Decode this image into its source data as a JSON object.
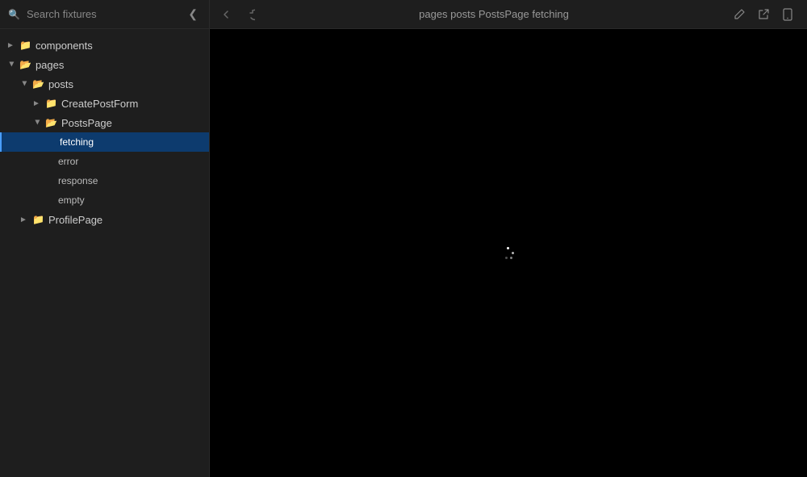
{
  "header": {
    "search_placeholder": "Search fixtures",
    "breadcrumb": "pages posts PostsPage fetching",
    "collapse_icon": "❮",
    "nav_back_icon": "←",
    "nav_forward_icon": "↻",
    "action_edit_icon": "edit",
    "action_external_icon": "external",
    "action_device_icon": "device"
  },
  "sidebar": {
    "tree": [
      {
        "id": "components",
        "label": "components",
        "type": "folder",
        "level": 1,
        "expanded": false,
        "children": []
      },
      {
        "id": "pages",
        "label": "pages",
        "type": "folder",
        "level": 1,
        "expanded": true,
        "children": [
          {
            "id": "posts",
            "label": "posts",
            "type": "folder",
            "level": 2,
            "expanded": true,
            "children": [
              {
                "id": "CreatePostForm",
                "label": "CreatePostForm",
                "type": "folder",
                "level": 3,
                "expanded": false,
                "children": []
              },
              {
                "id": "PostsPage",
                "label": "PostsPage",
                "type": "folder",
                "level": 3,
                "expanded": true,
                "children": [
                  {
                    "id": "fetching",
                    "label": "fetching",
                    "type": "fixture",
                    "level": 4,
                    "active": true
                  },
                  {
                    "id": "error",
                    "label": "error",
                    "type": "fixture",
                    "level": 4,
                    "active": false
                  },
                  {
                    "id": "response",
                    "label": "response",
                    "type": "fixture",
                    "level": 4,
                    "active": false
                  },
                  {
                    "id": "empty",
                    "label": "empty",
                    "type": "fixture",
                    "level": 4,
                    "active": false
                  }
                ]
              }
            ]
          },
          {
            "id": "ProfilePage",
            "label": "ProfilePage",
            "type": "folder",
            "level": 2,
            "expanded": false,
            "children": []
          }
        ]
      }
    ]
  },
  "main": {
    "background": "#000000",
    "loading": true
  },
  "colors": {
    "sidebar_bg": "#1e1e1e",
    "active_bg": "#0d3b6e",
    "active_border": "#4a9eff",
    "text_primary": "#cccccc",
    "text_muted": "#888888",
    "folder_color": "#dcb67a"
  }
}
